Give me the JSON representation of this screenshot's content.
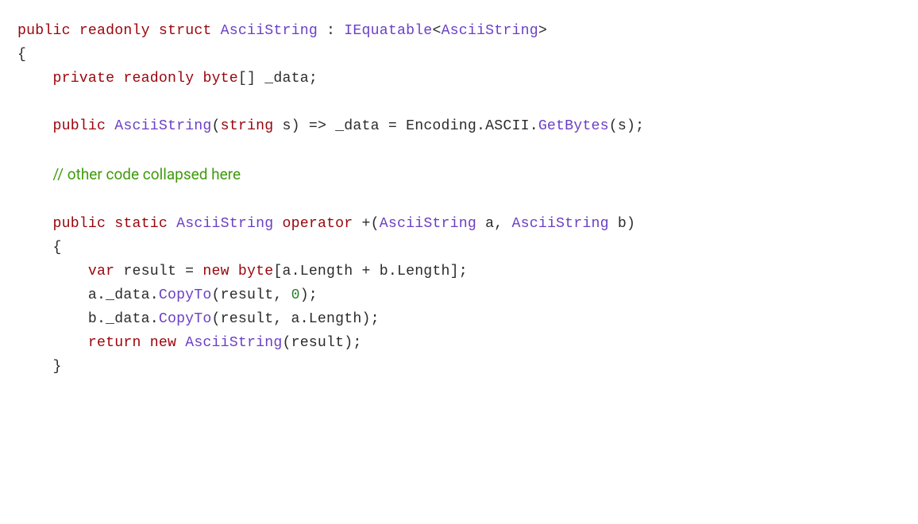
{
  "code": {
    "line1": {
      "kw_public": "public",
      "kw_readonly": "readonly",
      "kw_struct": "struct",
      "type_ascii": "AsciiString",
      "colon": " : ",
      "type_ieq": "IEquatable",
      "lt": "<",
      "type_ascii2": "AsciiString",
      "gt": ">"
    },
    "brace_open": "{",
    "line_field": {
      "indent": "    ",
      "kw_private": "private",
      "kw_readonly": "readonly",
      "kw_byte": "byte",
      "brackets": "[] ",
      "name": "_data",
      "semi": ";"
    },
    "line_ctor": {
      "indent": "    ",
      "kw_public": "public",
      "type_ascii": "AsciiString",
      "paren_open": "(",
      "kw_string": "string",
      "param": " s) ",
      "arrow": "=>",
      "assign_left": " _data = Encoding.ASCII.",
      "method": "GetBytes",
      "tail": "(s);"
    },
    "comment": {
      "indent": "    ",
      "text": "// other code collapsed here"
    },
    "line_op": {
      "indent": "    ",
      "kw_public": "public",
      "kw_static": "static",
      "type_ascii": "AsciiString",
      "kw_operator": "operator",
      "plus_open": " +(",
      "type_a": "AsciiString",
      "a": " a, ",
      "type_b": "AsciiString",
      "b": " b)"
    },
    "line_op_brace": "    {",
    "line_result": {
      "indent": "        ",
      "kw_var": "var",
      "name": " result = ",
      "kw_new": "new",
      "sp": " ",
      "kw_byte": "byte",
      "tail": "[a.Length + b.Length];"
    },
    "line_copy_a": {
      "indent": "        ",
      "prefix": "a._data.",
      "method": "CopyTo",
      "mid": "(result, ",
      "zero": "0",
      "tail": ");"
    },
    "line_copy_b": {
      "indent": "        ",
      "prefix": "b._data.",
      "method": "CopyTo",
      "tail": "(result, a.Length);"
    },
    "line_return": {
      "indent": "        ",
      "kw_return": "return",
      "sp": " ",
      "kw_new": "new",
      "sp2": " ",
      "type": "AsciiString",
      "tail": "(result);"
    },
    "line_op_brace_close": "    }"
  }
}
